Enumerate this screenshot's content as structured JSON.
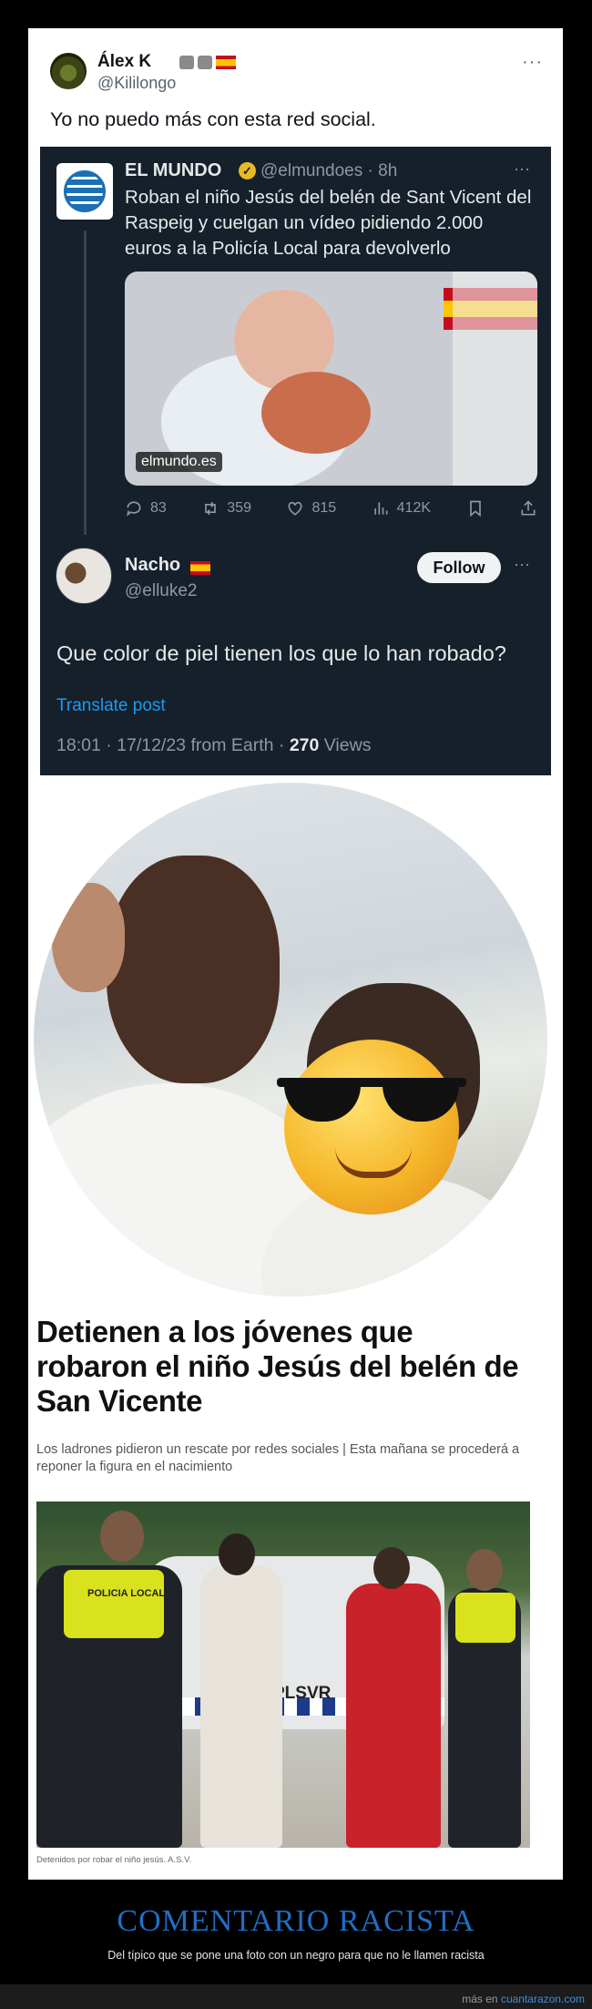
{
  "tweet": {
    "name": "Álex K",
    "handle": "@Kililongo",
    "more": "···",
    "text": "Yo no puedo más con esta red social."
  },
  "quoted": {
    "name": "EL MUNDO",
    "handle_time": "@elmundoes · 8h",
    "more": "···",
    "text": "Roban el niño Jesús del belén de Sant Vicent del Raspeig y cuelgan un vídeo pidiendo 2.000 euros a la Policía Local para devolverlo",
    "image_domain": "elmundo.es",
    "actions": {
      "replies": "83",
      "reposts": "359",
      "likes": "815",
      "views": "412K"
    }
  },
  "reply": {
    "name": "Nacho",
    "handle": "@elluke2",
    "follow_label": "Follow",
    "more": "···",
    "text": "Que color de piel tienen los que lo han robado?",
    "translate": "Translate post",
    "meta_prefix": "18:01 · 17/12/23 from Earth · ",
    "views_count": "270",
    "views_label": " Views"
  },
  "article": {
    "title": "Detienen a los jóvenes que robaron el niño Jesús del belén de San Vicente",
    "subtitle": "Los ladrones pidieron un rescate por redes sociales | Esta mañana se procederá a reponer la figura en el nacimiento",
    "photo_badge": "POLICIA LOCAL",
    "photo_plate": "PLSVR",
    "caption": "Detenidos por robar el niño jesús. A.S.V."
  },
  "footer": {
    "title": "COMENTARIO RACISTA",
    "subtitle": "Del típico que se pone una foto con un negro para que no le llamen racista",
    "credit_prefix": "más en ",
    "credit_site": "cuantarazon.com"
  },
  "colors": {
    "link": "#1d9bf0",
    "verified": "#e8b923",
    "footer_title": "#1f6fc5"
  }
}
